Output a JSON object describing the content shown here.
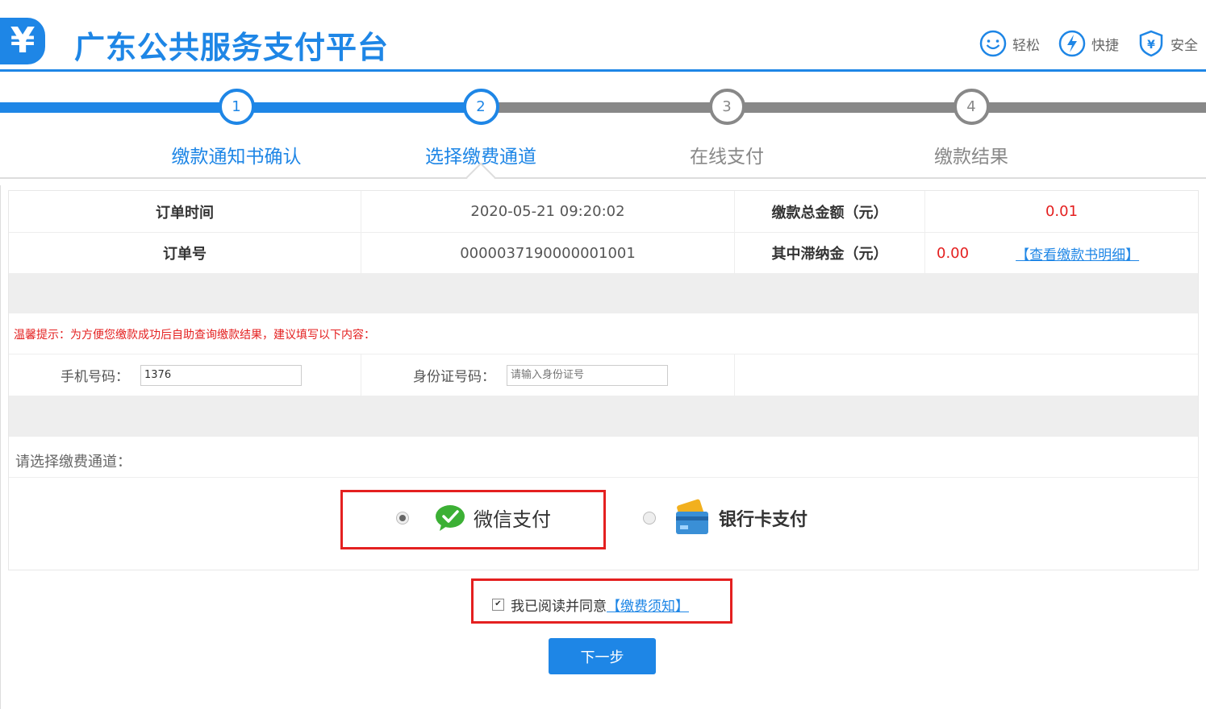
{
  "header": {
    "logo_symbol": "¥",
    "title": "广东公共服务支付平台",
    "features": [
      {
        "label": "轻松",
        "icon": "smile-icon"
      },
      {
        "label": "快捷",
        "icon": "lightning-icon"
      },
      {
        "label": "安全",
        "icon": "shield-icon"
      }
    ],
    "accent": "#1e86e6"
  },
  "steps": [
    {
      "num": "1",
      "label": "缴款通知书确认"
    },
    {
      "num": "2",
      "label": "选择缴费通道"
    },
    {
      "num": "3",
      "label": "在线支付"
    },
    {
      "num": "4",
      "label": "缴款结果"
    }
  ],
  "order": {
    "time_label": "订单时间",
    "time_value": "2020-05-21 09:20:02",
    "total_label": "缴款总金额（元）",
    "total_value": "0.01",
    "no_label": "订单号",
    "no_value": "0000037190000001001",
    "late_fee_label": "其中滞纳金（元）",
    "late_fee_value": "0.00",
    "detail_link": "【查看缴款书明细】"
  },
  "tip": "温馨提示：为方便您缴款成功后自助查询缴款结果，建议填写以下内容：",
  "form": {
    "phone_label": "手机号码：",
    "phone_value": "1376",
    "id_label": "身份证号码：",
    "id_placeholder": "请输入身份证号"
  },
  "channel": {
    "label": "请选择缴费通道：",
    "options": [
      {
        "label": "微信支付",
        "icon": "wechat-icon",
        "selected": true
      },
      {
        "label": "银行卡支付",
        "icon": "bank-card-icon",
        "selected": false
      }
    ]
  },
  "agreement": {
    "text": "我已阅读并同意",
    "link": "【缴费须知】",
    "checked": true
  },
  "next_button": "下一步",
  "colors": {
    "accent": "#1e86e6",
    "alert": "#e42020",
    "inactive": "#888888",
    "wechat": "#3cb035"
  }
}
